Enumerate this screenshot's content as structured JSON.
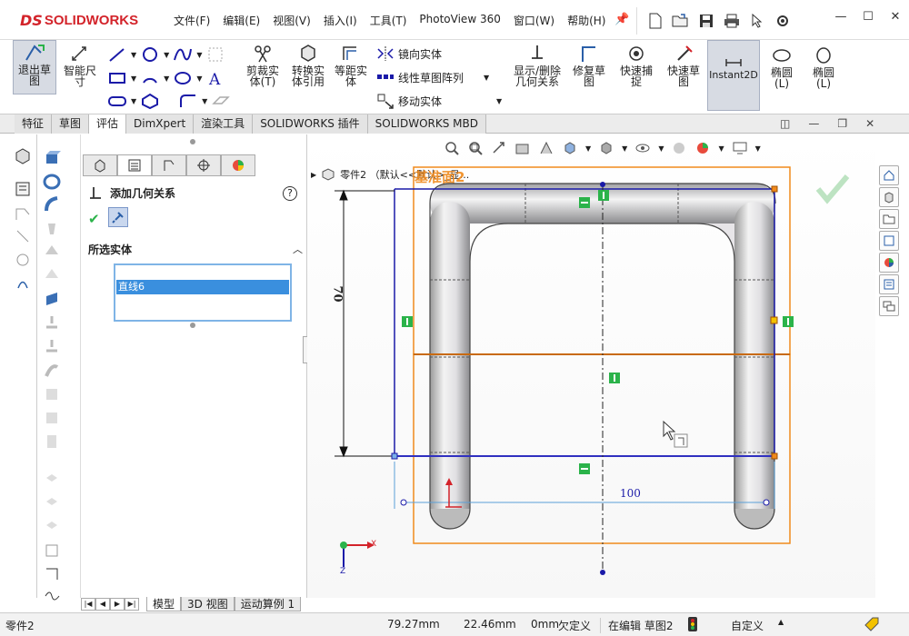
{
  "app": {
    "logo_ds": "DS",
    "logo_text": "SOLIDWORKS"
  },
  "menu": [
    "文件(F)",
    "编辑(E)",
    "视图(V)",
    "插入(I)",
    "工具(T)",
    "PhotoView 360",
    "窗口(W)",
    "帮助(H)"
  ],
  "quick_access": [
    "new-icon",
    "open-icon",
    "save-icon",
    "print-icon",
    "select-icon",
    "options-icon"
  ],
  "commands": {
    "exit_sketch": "退出草图",
    "smart_dim": "智能尺寸",
    "trim": "剪裁实体(T)",
    "convert": "转换实体引用",
    "offset": "等距实体",
    "mirror": "镜向实体",
    "linear_pattern": "线性草图阵列",
    "move": "移动实体",
    "show_delete_rel": "显示/删除几何关系",
    "repair": "修复草图",
    "quick_snap": "快速捕捉",
    "rapid_sketch": "快速草图",
    "instant2d": "Instant2D",
    "ellipse1": "椭圆(L)",
    "ellipse2": "椭圆(L)"
  },
  "command_tabs": [
    "特征",
    "草图",
    "评估",
    "DimXpert",
    "渲染工具",
    "SOLIDWORKS 插件",
    "SOLIDWORKS MBD"
  ],
  "active_tab": "评估",
  "property_manager": {
    "title": "添加几何关系",
    "section": "所选实体",
    "selected_items": [
      "直线6"
    ]
  },
  "viewport": {
    "tree_label": "零件2 （默认<<默认>_显...",
    "overlay_label": "基准面2",
    "dim_vertical": "70",
    "dim_horizontal": "100",
    "axis_x": "X",
    "axis_y": "Y",
    "axis_z": "Z"
  },
  "bottom_tabs": [
    "模型",
    "3D 视图",
    "运动算例 1"
  ],
  "active_bottom_tab": "模型",
  "status": {
    "name": "零件2",
    "x": "79.27mm",
    "y": "22.46mm",
    "z": "0mm",
    "defined": "欠定义",
    "editing": "在编辑 草图2",
    "units": "自定义"
  },
  "colors": {
    "brand": "#d3232a",
    "sketch_blue": "#1a1aa8",
    "orange": "#f08a1c",
    "relation_green": "#2bb34a"
  }
}
